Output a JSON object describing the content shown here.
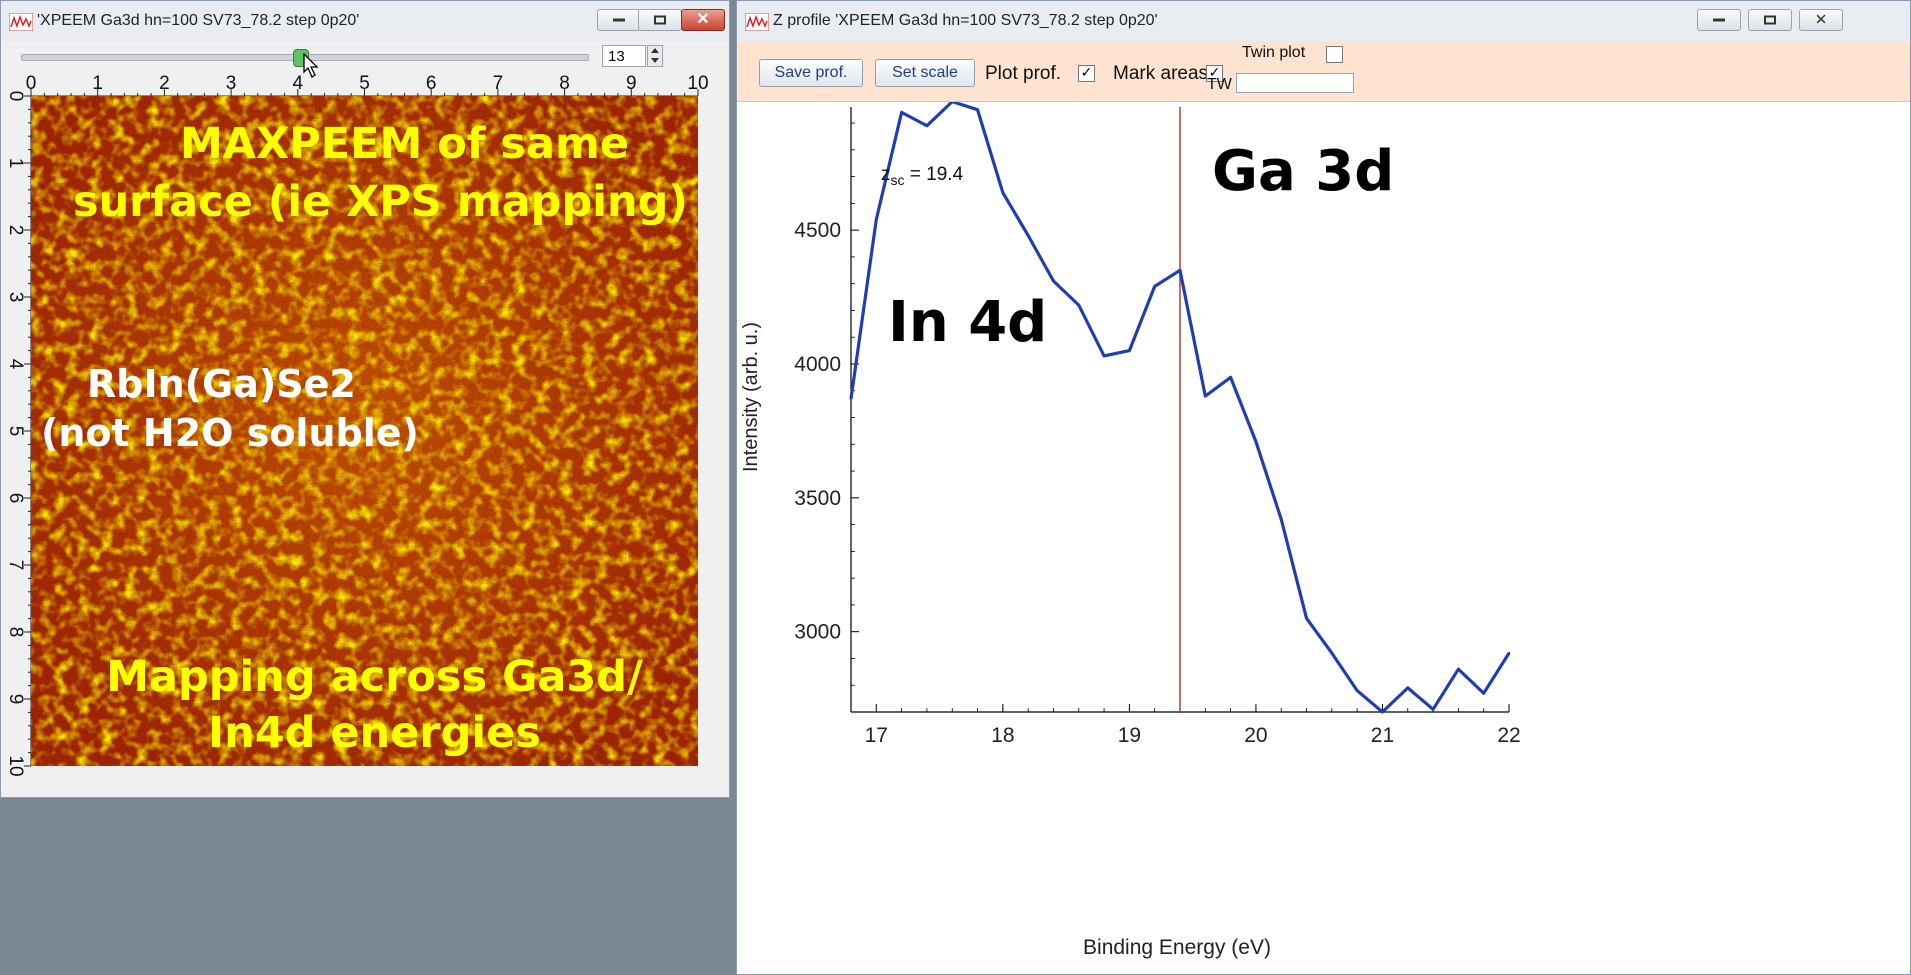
{
  "left_window": {
    "title": "'XPEEM Ga3d hn=100 SV73_78.2 step 0p20'",
    "slider": {
      "value": 13,
      "fraction": 0.48
    },
    "axis_ticks": [
      "0",
      "1",
      "2",
      "3",
      "4",
      "5",
      "6",
      "7",
      "8",
      "9",
      "10"
    ],
    "overlay": {
      "line1": "MAXPEEM of same",
      "line2": "surface (ie XPS mapping)",
      "line3": "RbIn(Ga)Se2",
      "line4": "(not H2O soluble)",
      "line5": "Mapping across Ga3d/",
      "line6": "In4d energies",
      "main_color": "#ffff00",
      "label_color": "#ffffff"
    }
  },
  "right_window": {
    "title": "Z profile 'XPEEM Ga3d hn=100 SV73_78.2 step 0p20'",
    "toolbar": {
      "save_prof": "Save prof.",
      "set_scale": "Set scale",
      "plot_prof": "Plot prof.",
      "plot_prof_checked": "✓",
      "mark_areas": "Mark areas",
      "mark_areas_checked": "✓",
      "twin_plot": "Twin plot",
      "tw": "TW",
      "tw_value": ""
    },
    "annotations": {
      "zsc_prefix": "z",
      "zsc_sub": "sc",
      "zsc_value": " = 19.4",
      "in4d": "In 4d",
      "ga3d": "Ga 3d"
    },
    "toolbar_bg": "#fde3d0"
  },
  "chart_data": {
    "type": "line",
    "xlabel": "Binding Energy (eV)",
    "ylabel": "Intensity (arb. u.)",
    "xlim": [
      16.8,
      22.0
    ],
    "ylim": [
      2700,
      4960
    ],
    "x_ticks": [
      17,
      18,
      19,
      20,
      21,
      22
    ],
    "y_ticks": [
      3000,
      3500,
      4000,
      4500
    ],
    "marker_x": 19.4,
    "line_color": "#1f3fb0",
    "marker_color": "#b04030",
    "series": [
      {
        "x": [
          16.8,
          17.0,
          17.2,
          17.4,
          17.6,
          17.8,
          18.0,
          18.2,
          18.4,
          18.6,
          18.8,
          19.0,
          19.2,
          19.4,
          19.6,
          19.8,
          20.0,
          20.2,
          20.4,
          20.6,
          20.8,
          21.0,
          21.2,
          21.4,
          21.6,
          21.8,
          22.0
        ],
        "y": [
          3870,
          4540,
          4940,
          4890,
          4980,
          4950,
          4640,
          4480,
          4310,
          4220,
          4030,
          4050,
          4290,
          4350,
          3880,
          3950,
          3710,
          3420,
          3050,
          2920,
          2780,
          2700,
          2790,
          2710,
          2860,
          2770,
          2920
        ]
      }
    ]
  }
}
